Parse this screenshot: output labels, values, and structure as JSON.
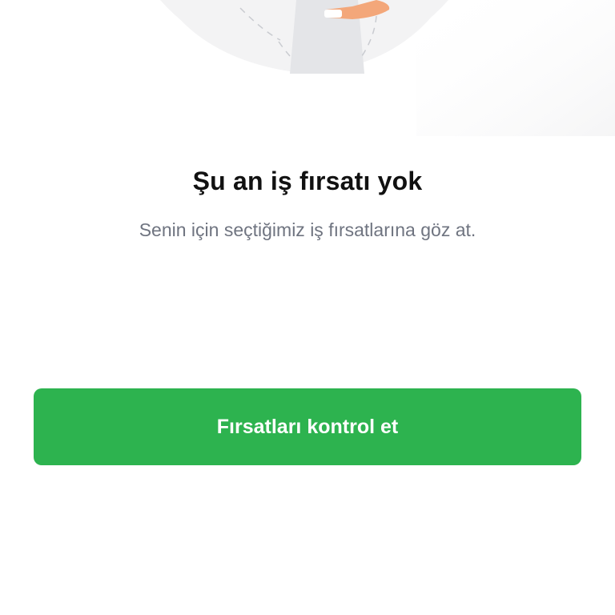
{
  "empty_state": {
    "title": "Şu an iş fırsatı yok",
    "subtitle": "Senin için seçtiğimiz iş fırsatlarına göz at.",
    "illustration_icon": "person-illustration-icon"
  },
  "cta": {
    "label": "Fırsatları kontrol et"
  },
  "colors": {
    "accent": "#2db34f",
    "title": "#111111",
    "subtitle": "#6f7480",
    "background": "#ffffff"
  }
}
